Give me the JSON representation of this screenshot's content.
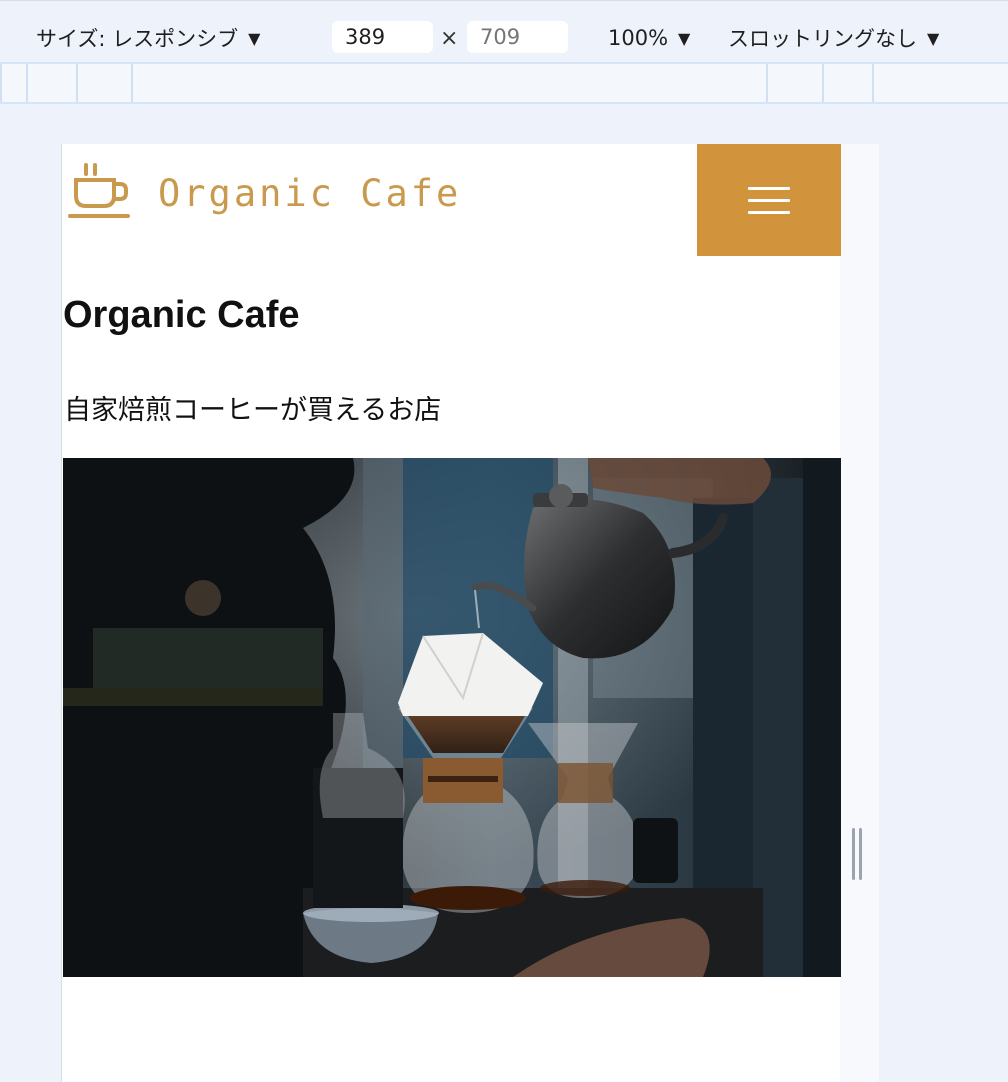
{
  "devtools": {
    "size_label": "サイズ: レスポンシブ",
    "width_value": "389",
    "height_placeholder": "709",
    "times_symbol": "×",
    "zoom_label": "100%",
    "throttling_label": "スロットリングなし",
    "dropdown_arrow": "▼"
  },
  "site": {
    "logo_text": "Organic Cafe",
    "title": "Organic Cafe",
    "tagline": "自家焙煎コーヒーが買えるお店",
    "hero_alt": "Barista pouring hot water from a kettle into Chemex coffee makers",
    "brand_color": "#d1933b",
    "logo_color": "#c99a4e"
  },
  "icons": {
    "logo": "coffee-cup-icon",
    "menu": "hamburger-menu-icon",
    "resize": "resize-handle-icon"
  }
}
